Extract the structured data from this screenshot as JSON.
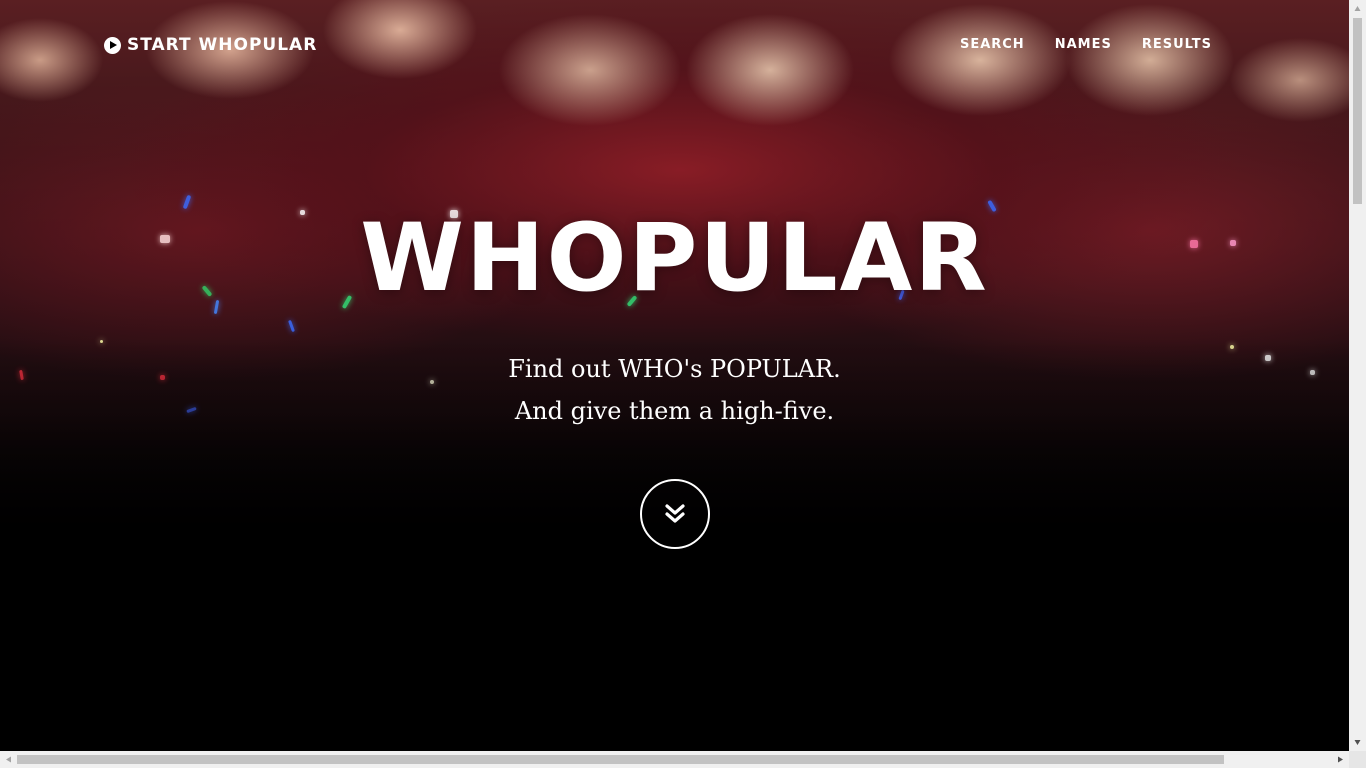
{
  "brand": {
    "label": "START WHOPULAR",
    "icon": "play-circle-icon"
  },
  "nav": {
    "items": [
      {
        "label": "SEARCH"
      },
      {
        "label": "NAMES"
      },
      {
        "label": "RESULTS"
      }
    ]
  },
  "hero": {
    "headline": "WHOPULAR",
    "tagline_line1": "Find out WHO's POPULAR.",
    "tagline_line2": "And give them a high-five.",
    "scroll_icon": "double-chevron-down-icon",
    "background_description_colors": {
      "crowd_red": "#5a1f22",
      "base": "#000000"
    }
  },
  "scrollbars": {
    "vertical_icon_up": "triangle-up-icon",
    "vertical_icon_down": "triangle-down-icon",
    "horizontal_icon_left": "triangle-left-icon",
    "horizontal_icon_right": "triangle-right-icon"
  }
}
